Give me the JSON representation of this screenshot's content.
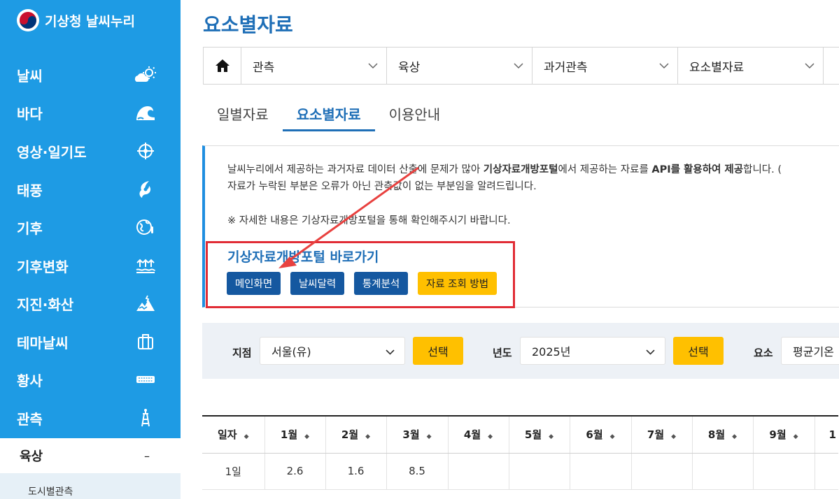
{
  "sidebar": {
    "logo": "기상청 날씨누리",
    "items": [
      {
        "label": "날씨",
        "icon": "weather-icon"
      },
      {
        "label": "바다",
        "icon": "wave-icon"
      },
      {
        "label": "영상·일기도",
        "icon": "satellite-icon"
      },
      {
        "label": "태풍",
        "icon": "typhoon-icon"
      },
      {
        "label": "기후",
        "icon": "climate-icon"
      },
      {
        "label": "기후변화",
        "icon": "climate-change-icon"
      },
      {
        "label": "지진·화산",
        "icon": "earthquake-icon"
      },
      {
        "label": "테마날씨",
        "icon": "suitcase-icon"
      },
      {
        "label": "황사",
        "icon": "dust-icon"
      },
      {
        "label": "관측",
        "icon": "observation-tower-icon"
      }
    ],
    "active": {
      "label": "육상",
      "toggle": "–"
    },
    "sub_item": "도시별관측"
  },
  "page": {
    "title": "요소별자료"
  },
  "breadcrumb": [
    "관측",
    "육상",
    "과거관측",
    "요소별자료"
  ],
  "tabs": [
    {
      "label": "일별자료",
      "active": false
    },
    {
      "label": "요소별자료",
      "active": true
    },
    {
      "label": "이용안내",
      "active": false
    }
  ],
  "notice": {
    "line1_a": "날씨누리에서 제공하는 과거자료 데이터 산출에 문제가 많아 ",
    "line1_b": "기상자료개방포털",
    "line1_c": "에서 제공하는 자료를 ",
    "line1_d": "API를 활용하여 제공",
    "line1_e": "합니다. (",
    "line2": "자료가 누락된 부분은 오류가 아닌 관측값이 없는 부분임을 알려드립니다.",
    "line3": "※ 자세한 내용은 기상자료개방포털을 통해 확인해주시기 바랍니다."
  },
  "portal": {
    "title": "기상자료개방포털 바로가기",
    "buttons": [
      "메인화면",
      "날씨달력",
      "통계분석",
      "자료 조회 방법"
    ]
  },
  "filter": {
    "station_label": "지점",
    "station_value": "서울(유)",
    "select_btn": "선택",
    "year_label": "년도",
    "year_value": "2025년",
    "element_label": "요소",
    "element_value": "평균기온"
  },
  "table": {
    "headers": [
      "일자",
      "1월",
      "2월",
      "3월",
      "4월",
      "5월",
      "6월",
      "7월",
      "8월",
      "9월",
      "1"
    ],
    "rows": [
      [
        "1일",
        "2.6",
        "1.6",
        "8.5",
        "",
        "",
        "",
        "",
        "",
        "",
        ""
      ]
    ]
  },
  "colors": {
    "sidebar": "#1e9be4",
    "accent": "#1f6fb7",
    "highlight_box": "#e12c35",
    "button_yellow": "#ffc000"
  }
}
